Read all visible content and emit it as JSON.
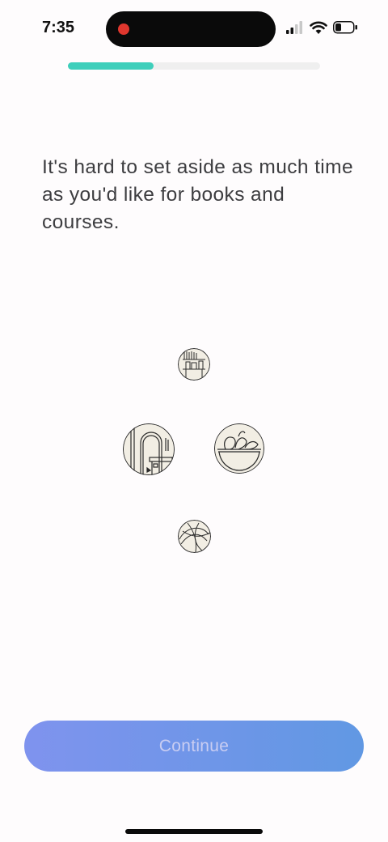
{
  "status_bar": {
    "time": "7:35",
    "recording_color": "#e0372e",
    "signal_icon": "cellular-signal-icon",
    "wifi_icon": "wifi-icon",
    "battery_icon": "battery-icon"
  },
  "progress": {
    "value": 0.34,
    "fill_color": "#3ecfbb",
    "track_color": "#efefef"
  },
  "headline": "It's hard to set aside as much time as you'd like for books and courses.",
  "illustrations": [
    {
      "name": "bookshelf-illustration"
    },
    {
      "name": "doorway-illustration"
    },
    {
      "name": "plant-bowl-illustration"
    },
    {
      "name": "abstract-lines-illustration"
    }
  ],
  "continue_button": {
    "label": "Continue",
    "gradient_start": "#7f93ee",
    "gradient_end": "#6198e3"
  }
}
